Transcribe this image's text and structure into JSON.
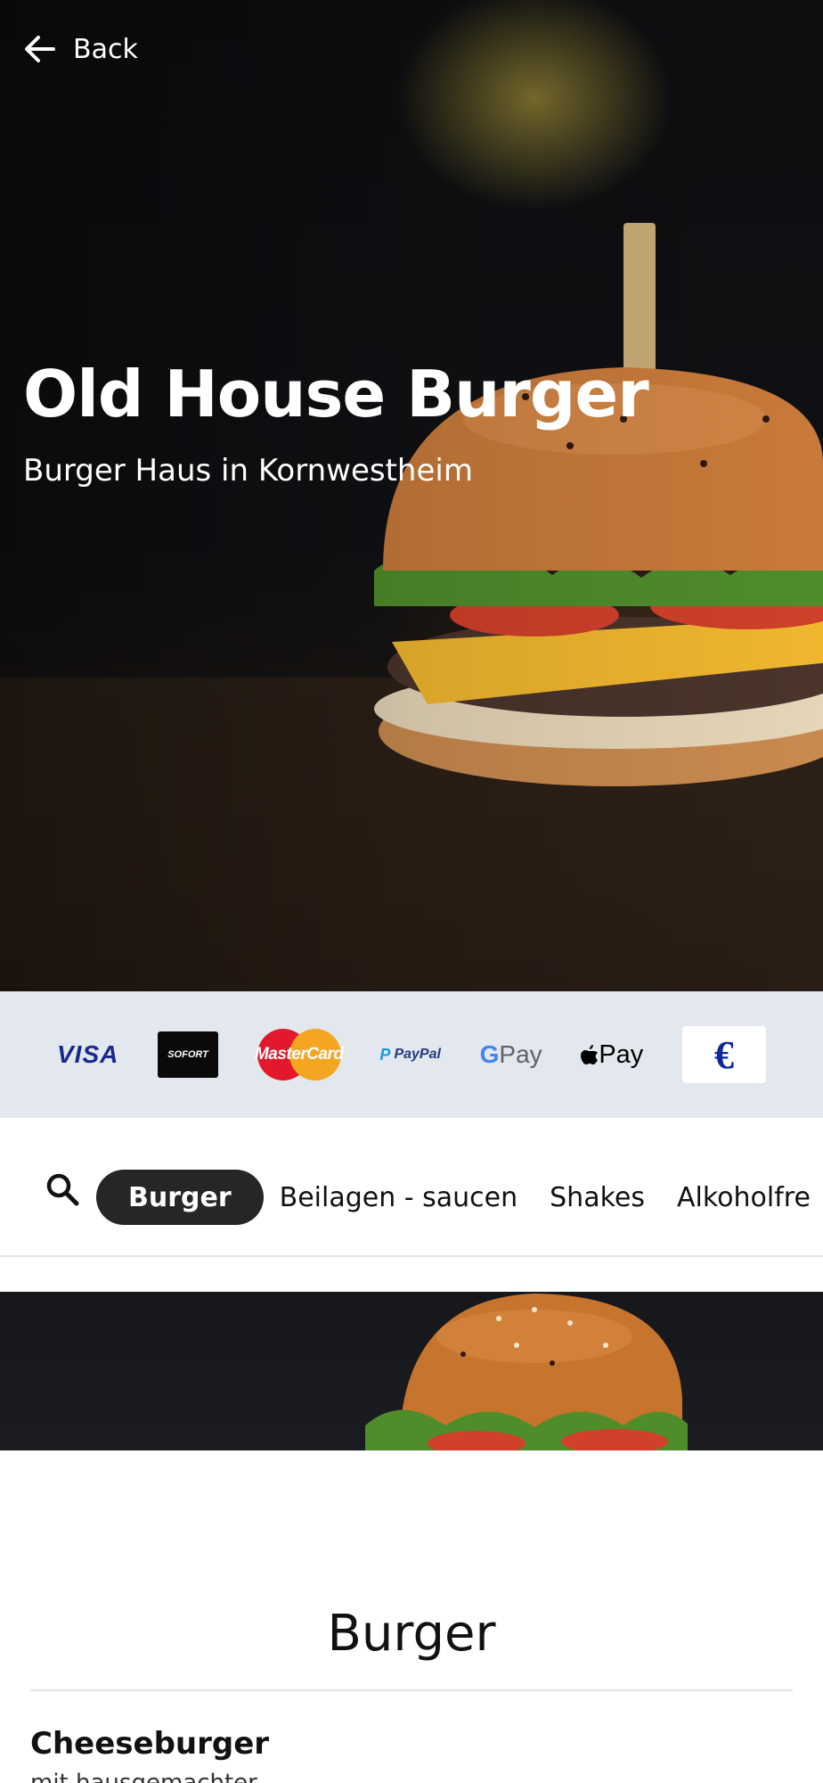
{
  "header": {
    "back_label": "Back",
    "title": "Old House Burger",
    "subtitle": "Burger Haus in Kornwestheim"
  },
  "payment_methods": [
    {
      "name": "visa",
      "label": "VISA"
    },
    {
      "name": "sofort",
      "label": "SOFORT"
    },
    {
      "name": "mastercard",
      "label": "MasterCard"
    },
    {
      "name": "paypal",
      "label": "PayPal"
    },
    {
      "name": "google-pay",
      "label": "Pay"
    },
    {
      "name": "apple-pay",
      "label": "Pay"
    },
    {
      "name": "cash",
      "label": "€"
    }
  ],
  "categories": {
    "active": "Burger",
    "items": [
      "Burger",
      "Beilagen - saucen",
      "Shakes",
      "Alkoholfre"
    ]
  },
  "section": {
    "title": "Burger"
  },
  "menu_item": {
    "name": "Cheeseburger",
    "description": "mit hausgemachter"
  },
  "icons": {
    "back": "arrow-left-icon",
    "search": "search-icon"
  },
  "colors": {
    "payment_bar_bg": "#e3e8ef",
    "active_tab_bg": "#262626",
    "hero_text": "#ffffff"
  }
}
